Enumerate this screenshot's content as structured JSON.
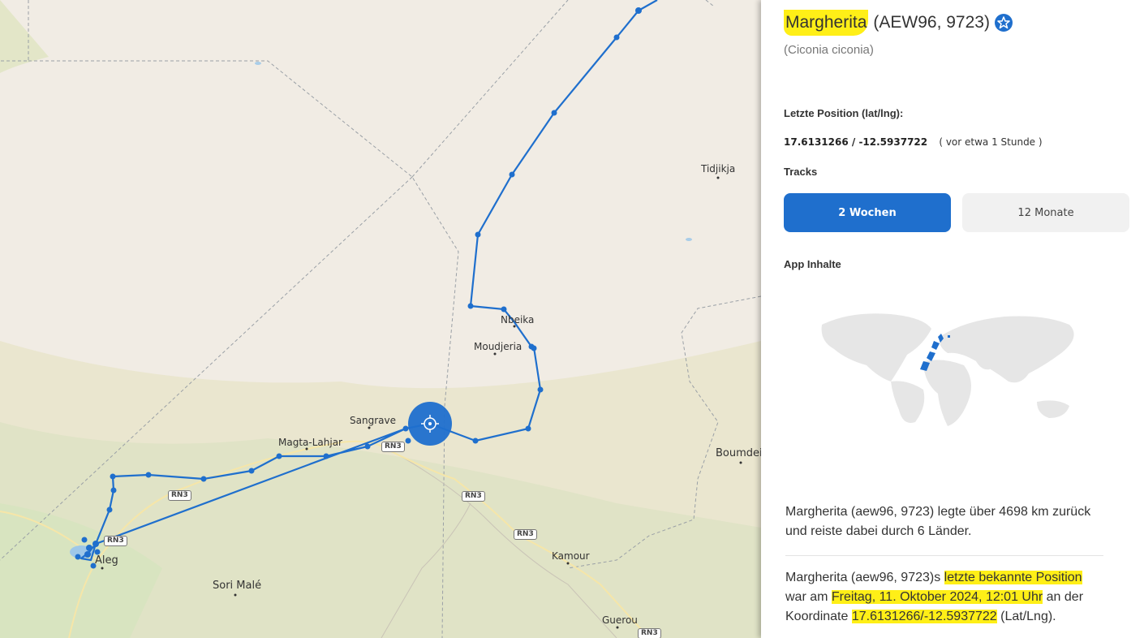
{
  "map": {
    "places": {
      "tidjikja": "Tidjikja",
      "nbeika": "Nbeika",
      "moudjeria": "Moudjeria",
      "sangrave": "Sangrave",
      "magta_lahjar": "Magta-Lahjar",
      "boumdeid": "Boumdei",
      "aleg": "Aleg",
      "sori_male": "Sori Malé",
      "kamour": "Kamour",
      "guerou": "Guerou"
    },
    "road_label": "RN3",
    "track_color": "#1f6fcd"
  },
  "panel": {
    "bird_name": "Margherita",
    "bird_ids": "(AEW96, 9723)",
    "species": "(Ciconia ciconia)",
    "favorite_icon": "star-badge-icon",
    "last_position_label": "Letzte Position (lat/lng):",
    "coordinates": "17.6131266 / -12.5937722",
    "time_ago": "( vor etwa 1 Stunde )",
    "tracks_label": "Tracks",
    "track_options": [
      "2 Wochen",
      "12 Monate"
    ],
    "selected_track": "2 Wochen",
    "app_content_label": "App Inhalte",
    "summary_text": "Margherita (aew96, 9723) legte über 4698 km zurück und reiste dabei durch 6 Länder.",
    "last_pos_prefix": "Margherita (aew96, 9723)s ",
    "last_pos_highlight1": "letzte bekannte Position",
    "last_pos_mid1": " war am ",
    "last_pos_highlight2": "Freitag, 11. Oktober 2024, 12:01 Uhr",
    "last_pos_mid2": " an der Koordinate ",
    "last_pos_highlight3": "17.6131266/-12.5937722",
    "last_pos_suffix": " (Lat/Lng).",
    "highlight_color": "#ffef17",
    "accent_color": "#1f6fcd"
  }
}
